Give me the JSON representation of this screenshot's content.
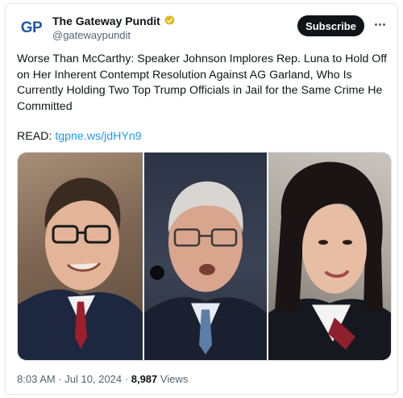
{
  "account": {
    "avatar_text": "GP",
    "display_name": "The Gateway Pundit",
    "handle": "@gatewaypundit",
    "verified_color": "#e2b719"
  },
  "actions": {
    "subscribe_label": "Subscribe",
    "more_icon": "more-horizontal-icon"
  },
  "tweet": {
    "text": "Worse Than McCarthy: Speaker Johnson Implores Rep. Luna to Hold Off on Her Inherent Contempt Resolution Against AG Garland, Who Is Currently Holding Two Top Trump Officials in Jail for the Same Crime He Committed",
    "read_label": "READ:",
    "link_text": "tgpne.ws/jdHYn9"
  },
  "meta": {
    "time": "8:03 AM",
    "separator": "·",
    "date": "Jul 10, 2024",
    "views_count": "8,987",
    "views_label": "Views"
  },
  "colors": {
    "link": "#1d9bf0",
    "text": "#0f1419",
    "secondary": "#536471",
    "brand": "#1f5aa6"
  }
}
